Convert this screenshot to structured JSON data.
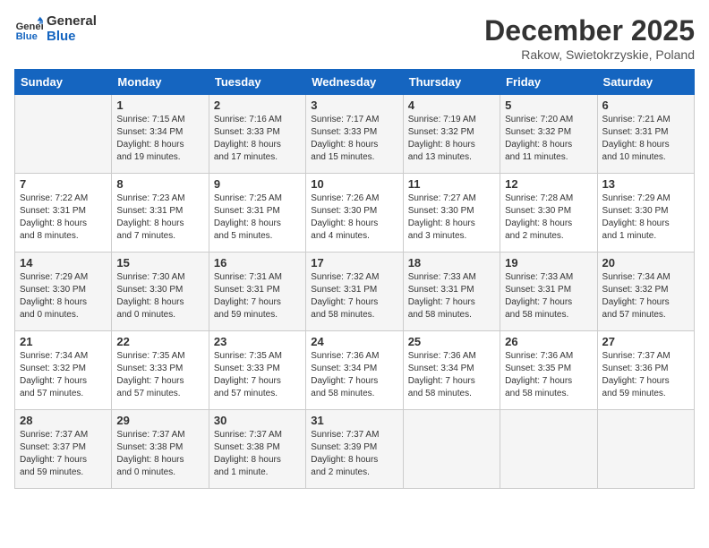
{
  "logo": {
    "line1": "General",
    "line2": "Blue"
  },
  "title": "December 2025",
  "location": "Rakow, Swietokrzyskie, Poland",
  "days_header": [
    "Sunday",
    "Monday",
    "Tuesday",
    "Wednesday",
    "Thursday",
    "Friday",
    "Saturday"
  ],
  "weeks": [
    [
      {
        "num": "",
        "info": ""
      },
      {
        "num": "1",
        "info": "Sunrise: 7:15 AM\nSunset: 3:34 PM\nDaylight: 8 hours\nand 19 minutes."
      },
      {
        "num": "2",
        "info": "Sunrise: 7:16 AM\nSunset: 3:33 PM\nDaylight: 8 hours\nand 17 minutes."
      },
      {
        "num": "3",
        "info": "Sunrise: 7:17 AM\nSunset: 3:33 PM\nDaylight: 8 hours\nand 15 minutes."
      },
      {
        "num": "4",
        "info": "Sunrise: 7:19 AM\nSunset: 3:32 PM\nDaylight: 8 hours\nand 13 minutes."
      },
      {
        "num": "5",
        "info": "Sunrise: 7:20 AM\nSunset: 3:32 PM\nDaylight: 8 hours\nand 11 minutes."
      },
      {
        "num": "6",
        "info": "Sunrise: 7:21 AM\nSunset: 3:31 PM\nDaylight: 8 hours\nand 10 minutes."
      }
    ],
    [
      {
        "num": "7",
        "info": "Sunrise: 7:22 AM\nSunset: 3:31 PM\nDaylight: 8 hours\nand 8 minutes."
      },
      {
        "num": "8",
        "info": "Sunrise: 7:23 AM\nSunset: 3:31 PM\nDaylight: 8 hours\nand 7 minutes."
      },
      {
        "num": "9",
        "info": "Sunrise: 7:25 AM\nSunset: 3:31 PM\nDaylight: 8 hours\nand 5 minutes."
      },
      {
        "num": "10",
        "info": "Sunrise: 7:26 AM\nSunset: 3:30 PM\nDaylight: 8 hours\nand 4 minutes."
      },
      {
        "num": "11",
        "info": "Sunrise: 7:27 AM\nSunset: 3:30 PM\nDaylight: 8 hours\nand 3 minutes."
      },
      {
        "num": "12",
        "info": "Sunrise: 7:28 AM\nSunset: 3:30 PM\nDaylight: 8 hours\nand 2 minutes."
      },
      {
        "num": "13",
        "info": "Sunrise: 7:29 AM\nSunset: 3:30 PM\nDaylight: 8 hours\nand 1 minute."
      }
    ],
    [
      {
        "num": "14",
        "info": "Sunrise: 7:29 AM\nSunset: 3:30 PM\nDaylight: 8 hours\nand 0 minutes."
      },
      {
        "num": "15",
        "info": "Sunrise: 7:30 AM\nSunset: 3:30 PM\nDaylight: 8 hours\nand 0 minutes."
      },
      {
        "num": "16",
        "info": "Sunrise: 7:31 AM\nSunset: 3:31 PM\nDaylight: 7 hours\nand 59 minutes."
      },
      {
        "num": "17",
        "info": "Sunrise: 7:32 AM\nSunset: 3:31 PM\nDaylight: 7 hours\nand 58 minutes."
      },
      {
        "num": "18",
        "info": "Sunrise: 7:33 AM\nSunset: 3:31 PM\nDaylight: 7 hours\nand 58 minutes."
      },
      {
        "num": "19",
        "info": "Sunrise: 7:33 AM\nSunset: 3:31 PM\nDaylight: 7 hours\nand 58 minutes."
      },
      {
        "num": "20",
        "info": "Sunrise: 7:34 AM\nSunset: 3:32 PM\nDaylight: 7 hours\nand 57 minutes."
      }
    ],
    [
      {
        "num": "21",
        "info": "Sunrise: 7:34 AM\nSunset: 3:32 PM\nDaylight: 7 hours\nand 57 minutes."
      },
      {
        "num": "22",
        "info": "Sunrise: 7:35 AM\nSunset: 3:33 PM\nDaylight: 7 hours\nand 57 minutes."
      },
      {
        "num": "23",
        "info": "Sunrise: 7:35 AM\nSunset: 3:33 PM\nDaylight: 7 hours\nand 57 minutes."
      },
      {
        "num": "24",
        "info": "Sunrise: 7:36 AM\nSunset: 3:34 PM\nDaylight: 7 hours\nand 58 minutes."
      },
      {
        "num": "25",
        "info": "Sunrise: 7:36 AM\nSunset: 3:34 PM\nDaylight: 7 hours\nand 58 minutes."
      },
      {
        "num": "26",
        "info": "Sunrise: 7:36 AM\nSunset: 3:35 PM\nDaylight: 7 hours\nand 58 minutes."
      },
      {
        "num": "27",
        "info": "Sunrise: 7:37 AM\nSunset: 3:36 PM\nDaylight: 7 hours\nand 59 minutes."
      }
    ],
    [
      {
        "num": "28",
        "info": "Sunrise: 7:37 AM\nSunset: 3:37 PM\nDaylight: 7 hours\nand 59 minutes."
      },
      {
        "num": "29",
        "info": "Sunrise: 7:37 AM\nSunset: 3:38 PM\nDaylight: 8 hours\nand 0 minutes."
      },
      {
        "num": "30",
        "info": "Sunrise: 7:37 AM\nSunset: 3:38 PM\nDaylight: 8 hours\nand 1 minute."
      },
      {
        "num": "31",
        "info": "Sunrise: 7:37 AM\nSunset: 3:39 PM\nDaylight: 8 hours\nand 2 minutes."
      },
      {
        "num": "",
        "info": ""
      },
      {
        "num": "",
        "info": ""
      },
      {
        "num": "",
        "info": ""
      }
    ]
  ]
}
